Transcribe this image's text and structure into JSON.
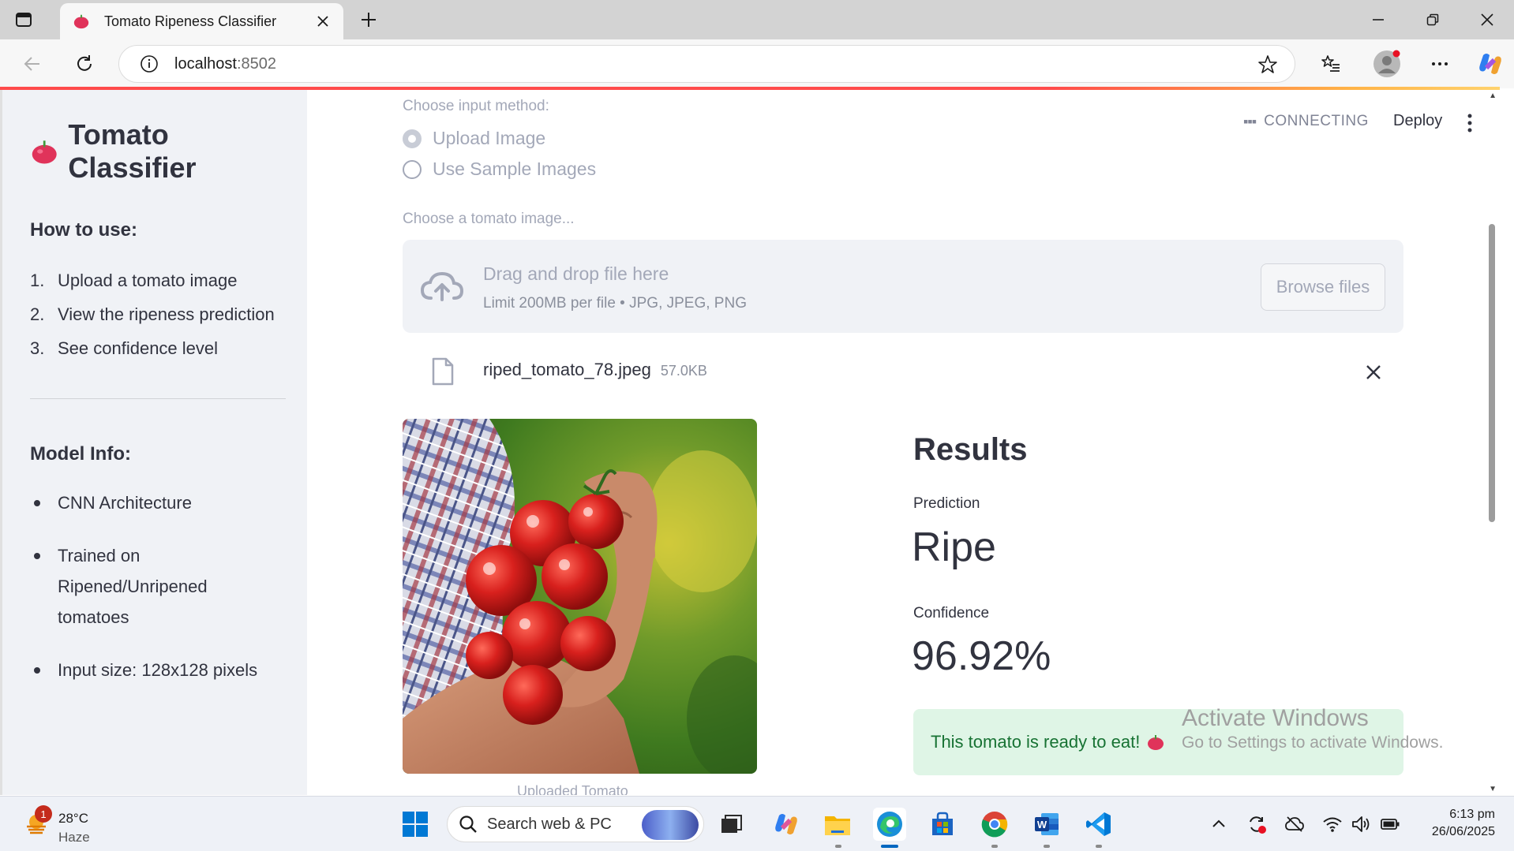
{
  "browser": {
    "tab_title": "Tomato Ripeness Classifier",
    "url_host": "localhost",
    "url_port": ":8502"
  },
  "sidebar": {
    "title": "Tomato Classifier",
    "how_heading": "How to use:",
    "steps": [
      {
        "num": "1.",
        "text": "Upload a tomato image"
      },
      {
        "num": "2.",
        "text": "View the ripeness prediction"
      },
      {
        "num": "3.",
        "text": "See confidence level"
      }
    ],
    "model_heading": "Model Info:",
    "model_items": [
      "CNN Architecture",
      "Trained on Ripened/Unripened tomatoes",
      "Input size: 128x128 pixels"
    ]
  },
  "header": {
    "status": "CONNECTING",
    "deploy": "Deploy"
  },
  "main": {
    "input_label": "Choose input method:",
    "radio_options": [
      "Upload Image",
      "Use Sample Images"
    ],
    "radio_selected": 0,
    "uploader_label": "Choose a tomato image...",
    "dropzone_main": "Drag and drop file here",
    "dropzone_sub": "Limit 200MB per file • JPG, JPEG, PNG",
    "browse_label": "Browse files",
    "file_name": "riped_tomato_78.jpeg",
    "file_size": "57.0KB",
    "caption": "Uploaded Tomato",
    "results_heading": "Results",
    "prediction_label": "Prediction",
    "prediction_value": "Ripe",
    "confidence_label": "Confidence",
    "confidence_value": "96.92%",
    "success_text": "This tomato is ready to eat!"
  },
  "watermark": {
    "line1": "Activate Windows",
    "line2": "Go to Settings to activate Windows."
  },
  "taskbar": {
    "weather_badge": "1",
    "temperature": "28°C",
    "condition": "Haze",
    "search_placeholder": "Search web & PC",
    "time": "6:13 pm",
    "date": "26/06/2025"
  },
  "colors": {
    "accent": "#ff4b4b",
    "sidebar_bg": "#f0f2f6",
    "success_bg": "#dff5e6",
    "success_text": "#177233",
    "muted_text": "#a3a8b8"
  }
}
